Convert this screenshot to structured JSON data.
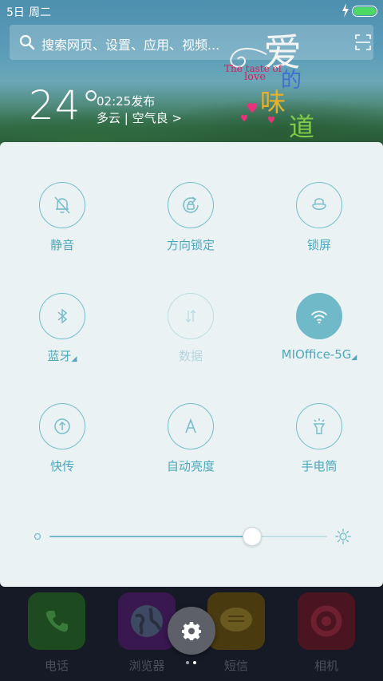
{
  "status": {
    "date": "5日",
    "day": "周二"
  },
  "search": {
    "placeholder": "搜索网页、设置、应用、视频..."
  },
  "weather": {
    "temperature": "24°",
    "published": "02:25发布",
    "description": "多云 | 空气良 >"
  },
  "wallpaper_logo": {
    "ai": "爱",
    "de": "的",
    "wei": "味",
    "dao": "道",
    "english_line1": "The taste of",
    "english_line2": "love"
  },
  "toggles": [
    {
      "label": "静音",
      "icon": "bell-mute-icon",
      "state": "off"
    },
    {
      "label": "方向锁定",
      "icon": "rotation-lock-icon",
      "state": "off"
    },
    {
      "label": "锁屏",
      "icon": "lock-icon",
      "state": "off"
    },
    {
      "label": "蓝牙",
      "icon": "bluetooth-icon",
      "state": "off"
    },
    {
      "label": "数据",
      "icon": "mobile-data-icon",
      "state": "disabled"
    },
    {
      "label": "MIOffice-5G",
      "icon": "wifi-icon",
      "state": "on"
    },
    {
      "label": "快传",
      "icon": "quick-transfer-icon",
      "state": "off"
    },
    {
      "label": "自动亮度",
      "icon": "auto-brightness-icon",
      "state": "off"
    },
    {
      "label": "手电筒",
      "icon": "flashlight-icon",
      "state": "off"
    }
  ],
  "brightness": {
    "level": 0.73
  },
  "dock": {
    "apps": [
      {
        "label": "电话",
        "icon": "phone-icon",
        "color": "#1f4a1f"
      },
      {
        "label": "浏览器",
        "icon": "browser-icon",
        "color": "#3b1a52"
      },
      {
        "label": "短信",
        "icon": "message-icon",
        "color": "#4a3d12"
      },
      {
        "label": "相机",
        "icon": "camera-icon",
        "color": "#4a1420"
      }
    ]
  },
  "colors": {
    "accent": "#4ea7bb",
    "active_toggle": "#6fb9c8",
    "panel_background": "#eaf2f3",
    "battery": "#4cd964"
  }
}
